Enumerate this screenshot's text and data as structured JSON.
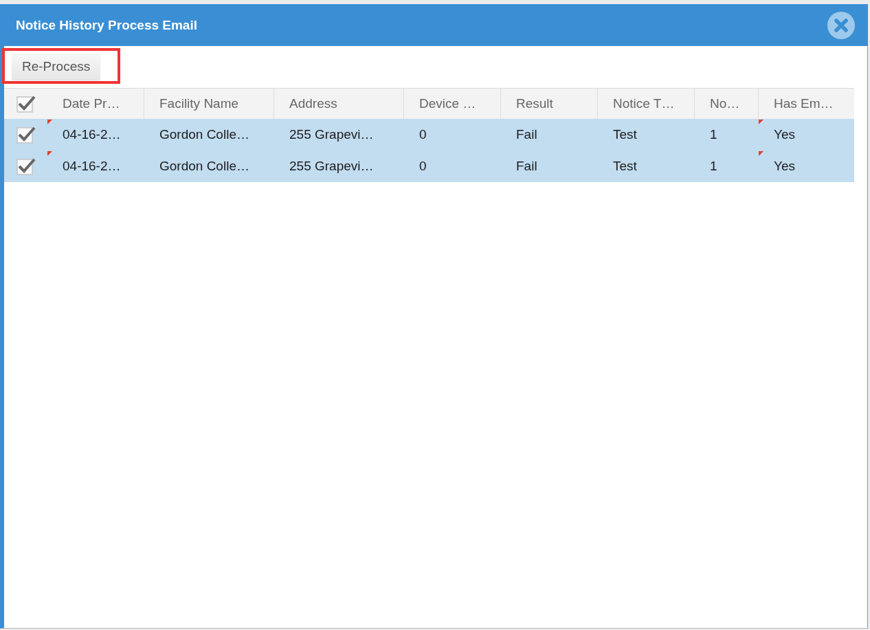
{
  "window": {
    "title": "Notice History Process Email"
  },
  "toolbar": {
    "buttons": [
      {
        "label": "Re-Process",
        "highlighted": true
      }
    ]
  },
  "table": {
    "select_all": {
      "checked": true
    },
    "columns": [
      "Date Pr…",
      "Facility Name",
      "Address",
      "Device …",
      "Result",
      "Notice T…",
      "No…",
      "Has Em…"
    ],
    "rows": [
      {
        "selected": true,
        "checked": true,
        "cells": [
          {
            "text": "04-16-2…",
            "modified": true
          },
          {
            "text": "Gordon Colle…",
            "modified": false
          },
          {
            "text": "255 Grapevi…",
            "modified": false
          },
          {
            "text": "0",
            "modified": false
          },
          {
            "text": "Fail",
            "modified": false
          },
          {
            "text": "Test",
            "modified": false
          },
          {
            "text": "1",
            "modified": false
          },
          {
            "text": "Yes",
            "modified": true
          }
        ]
      },
      {
        "selected": true,
        "checked": true,
        "cells": [
          {
            "text": "04-16-2…",
            "modified": true
          },
          {
            "text": "Gordon Colle…",
            "modified": false
          },
          {
            "text": "255 Grapevi…",
            "modified": false
          },
          {
            "text": "0",
            "modified": false
          },
          {
            "text": "Fail",
            "modified": false
          },
          {
            "text": "Test",
            "modified": false
          },
          {
            "text": "1",
            "modified": false
          },
          {
            "text": "Yes",
            "modified": true
          }
        ]
      }
    ]
  }
}
